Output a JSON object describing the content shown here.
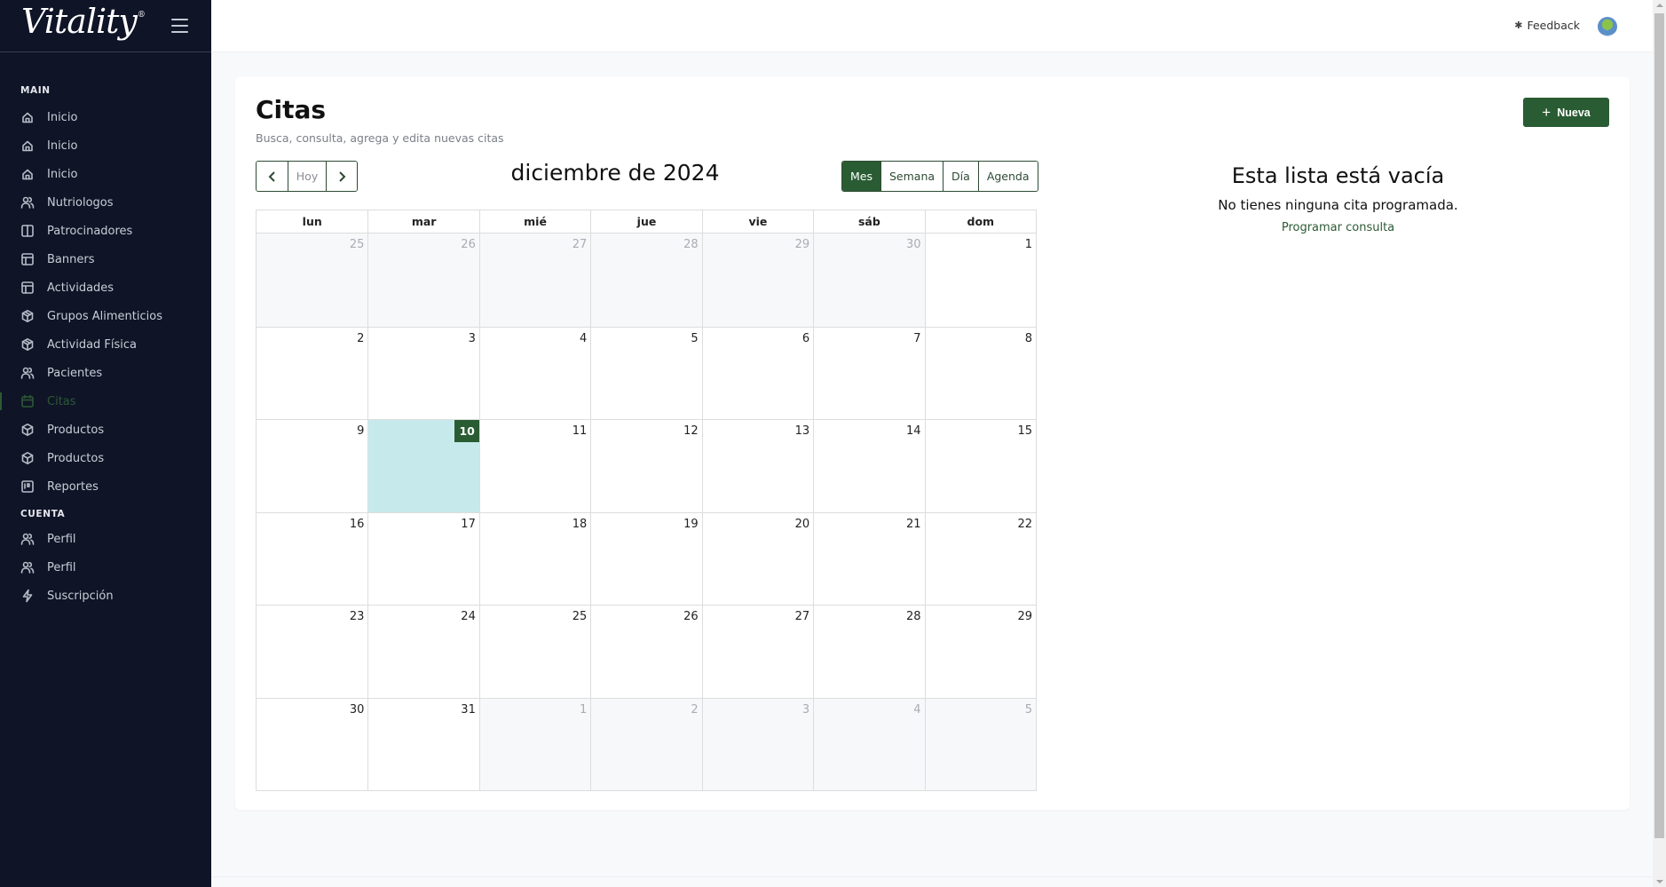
{
  "app": {
    "logo_text": "Vitality",
    "logo_mark": "®"
  },
  "sidebar": {
    "sections": [
      {
        "title": "MAIN",
        "items": [
          {
            "label": "Inicio",
            "icon": "home-icon",
            "active": false
          },
          {
            "label": "Inicio",
            "icon": "home-icon",
            "active": false
          },
          {
            "label": "Inicio",
            "icon": "home-icon",
            "active": false
          },
          {
            "label": "Nutriologos",
            "icon": "users-icon",
            "active": false
          },
          {
            "label": "Patrocinadores",
            "icon": "columns-icon",
            "active": false
          },
          {
            "label": "Banners",
            "icon": "layout-icon",
            "active": false
          },
          {
            "label": "Actividades",
            "icon": "layout-icon",
            "active": false
          },
          {
            "label": "Grupos Alimenticios",
            "icon": "cubes-icon",
            "active": false
          },
          {
            "label": "Actividad Física",
            "icon": "cubes-icon",
            "active": false
          },
          {
            "label": "Pacientes",
            "icon": "users-icon",
            "active": false
          },
          {
            "label": "Citas",
            "icon": "calendar-icon",
            "active": true
          },
          {
            "label": "Productos",
            "icon": "box-icon",
            "active": false
          },
          {
            "label": "Productos",
            "icon": "box-icon",
            "active": false
          },
          {
            "label": "Reportes",
            "icon": "report-icon",
            "active": false
          }
        ]
      },
      {
        "title": "CUENTA",
        "items": [
          {
            "label": "Perfil",
            "icon": "users-icon",
            "active": false
          },
          {
            "label": "Perfil",
            "icon": "users-icon",
            "active": false
          },
          {
            "label": "Suscripción",
            "icon": "bolt-icon",
            "active": false
          }
        ]
      }
    ]
  },
  "topbar": {
    "feedback_label": "Feedback",
    "feedback_icon": "bug-icon"
  },
  "page": {
    "title": "Citas",
    "subtitle": "Busca, consulta, agrega y edita nuevas citas",
    "new_button_label": "Nueva",
    "new_button_icon": "plus-icon"
  },
  "calendar": {
    "title": "diciembre de 2024",
    "today_label": "Hoy",
    "views": [
      {
        "label": "Mes",
        "active": true
      },
      {
        "label": "Semana",
        "active": false
      },
      {
        "label": "Día",
        "active": false
      },
      {
        "label": "Agenda",
        "active": false
      }
    ],
    "weekdays": [
      "lun",
      "mar",
      "mié",
      "jue",
      "vie",
      "sáb",
      "dom"
    ],
    "today": 10,
    "weeks": [
      [
        {
          "d": "25",
          "off": true
        },
        {
          "d": "26",
          "off": true
        },
        {
          "d": "27",
          "off": true
        },
        {
          "d": "28",
          "off": true
        },
        {
          "d": "29",
          "off": true
        },
        {
          "d": "30",
          "off": true
        },
        {
          "d": "1",
          "off": false
        }
      ],
      [
        {
          "d": "2",
          "off": false
        },
        {
          "d": "3",
          "off": false
        },
        {
          "d": "4",
          "off": false
        },
        {
          "d": "5",
          "off": false
        },
        {
          "d": "6",
          "off": false
        },
        {
          "d": "7",
          "off": false
        },
        {
          "d": "8",
          "off": false
        }
      ],
      [
        {
          "d": "9",
          "off": false
        },
        {
          "d": "10",
          "off": false,
          "today": true
        },
        {
          "d": "11",
          "off": false
        },
        {
          "d": "12",
          "off": false
        },
        {
          "d": "13",
          "off": false
        },
        {
          "d": "14",
          "off": false
        },
        {
          "d": "15",
          "off": false
        }
      ],
      [
        {
          "d": "16",
          "off": false
        },
        {
          "d": "17",
          "off": false
        },
        {
          "d": "18",
          "off": false
        },
        {
          "d": "19",
          "off": false
        },
        {
          "d": "20",
          "off": false
        },
        {
          "d": "21",
          "off": false
        },
        {
          "d": "22",
          "off": false
        }
      ],
      [
        {
          "d": "23",
          "off": false
        },
        {
          "d": "24",
          "off": false
        },
        {
          "d": "25",
          "off": false
        },
        {
          "d": "26",
          "off": false
        },
        {
          "d": "27",
          "off": false
        },
        {
          "d": "28",
          "off": false
        },
        {
          "d": "29",
          "off": false
        }
      ],
      [
        {
          "d": "30",
          "off": false
        },
        {
          "d": "31",
          "off": false
        },
        {
          "d": "1",
          "off": true
        },
        {
          "d": "2",
          "off": true
        },
        {
          "d": "3",
          "off": true
        },
        {
          "d": "4",
          "off": true
        },
        {
          "d": "5",
          "off": true
        }
      ]
    ]
  },
  "empty_state": {
    "title": "Esta lista está vacía",
    "message": "No tienes ninguna cita programada.",
    "link_label": "Programar consulta"
  },
  "colors": {
    "brand_green": "#2a5c33",
    "sidebar_bg": "#0f1427",
    "today_bg": "#c6eaec"
  }
}
